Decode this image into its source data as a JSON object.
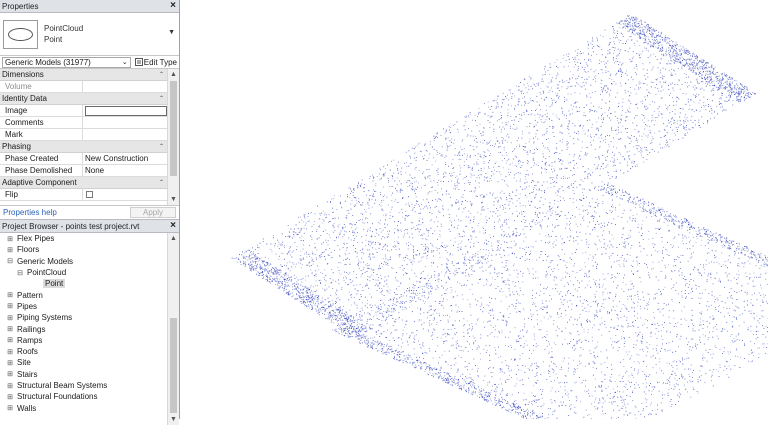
{
  "properties": {
    "title": "Properties",
    "close": "×",
    "type_name": "PointCloud",
    "type_sub": "Point",
    "category_select": "Generic Models (31977)",
    "edit_type": "Edit Type",
    "groups": {
      "dimensions": "Dimensions",
      "identity": "Identity Data",
      "phasing": "Phasing",
      "adaptive": "Adaptive Component"
    },
    "rows": {
      "volume": "Volume",
      "image": "Image",
      "comments": "Comments",
      "mark": "Mark",
      "phase_created": "Phase Created",
      "phase_created_value": "New Construction",
      "phase_demolished": "Phase Demolished",
      "phase_demolished_value": "None",
      "flip": "Flip"
    },
    "help_link": "Properties help",
    "apply": "Apply"
  },
  "browser": {
    "title": "Project Browser - points test project.rvt",
    "close": "×",
    "items": [
      {
        "label": "Flex Pipes",
        "toggle": "⊞",
        "level": 1
      },
      {
        "label": "Floors",
        "toggle": "⊞",
        "level": 1
      },
      {
        "label": "Generic Models",
        "toggle": "⊟",
        "level": 1
      },
      {
        "label": "PointCloud",
        "toggle": "⊟",
        "level": 2
      },
      {
        "label": "Point",
        "toggle": "",
        "level": 3,
        "selected": true
      },
      {
        "label": "Pattern",
        "toggle": "⊞",
        "level": 1
      },
      {
        "label": "Pipes",
        "toggle": "⊞",
        "level": 1
      },
      {
        "label": "Piping Systems",
        "toggle": "⊞",
        "level": 1
      },
      {
        "label": "Railings",
        "toggle": "⊞",
        "level": 1
      },
      {
        "label": "Ramps",
        "toggle": "⊞",
        "level": 1
      },
      {
        "label": "Roofs",
        "toggle": "⊞",
        "level": 1
      },
      {
        "label": "Site",
        "toggle": "⊞",
        "level": 1
      },
      {
        "label": "Stairs",
        "toggle": "⊞",
        "level": 1
      },
      {
        "label": "Structural Beam Systems",
        "toggle": "⊞",
        "level": 1
      },
      {
        "label": "Structural Foundations",
        "toggle": "⊞",
        "level": 1
      },
      {
        "label": "Walls",
        "toggle": "⊞",
        "level": 1
      }
    ]
  },
  "colors": {
    "panel_header": "#dfe3e8",
    "group_header": "#e6e6e6",
    "link": "#2a62b8",
    "point_cloud": "#3344bb"
  }
}
